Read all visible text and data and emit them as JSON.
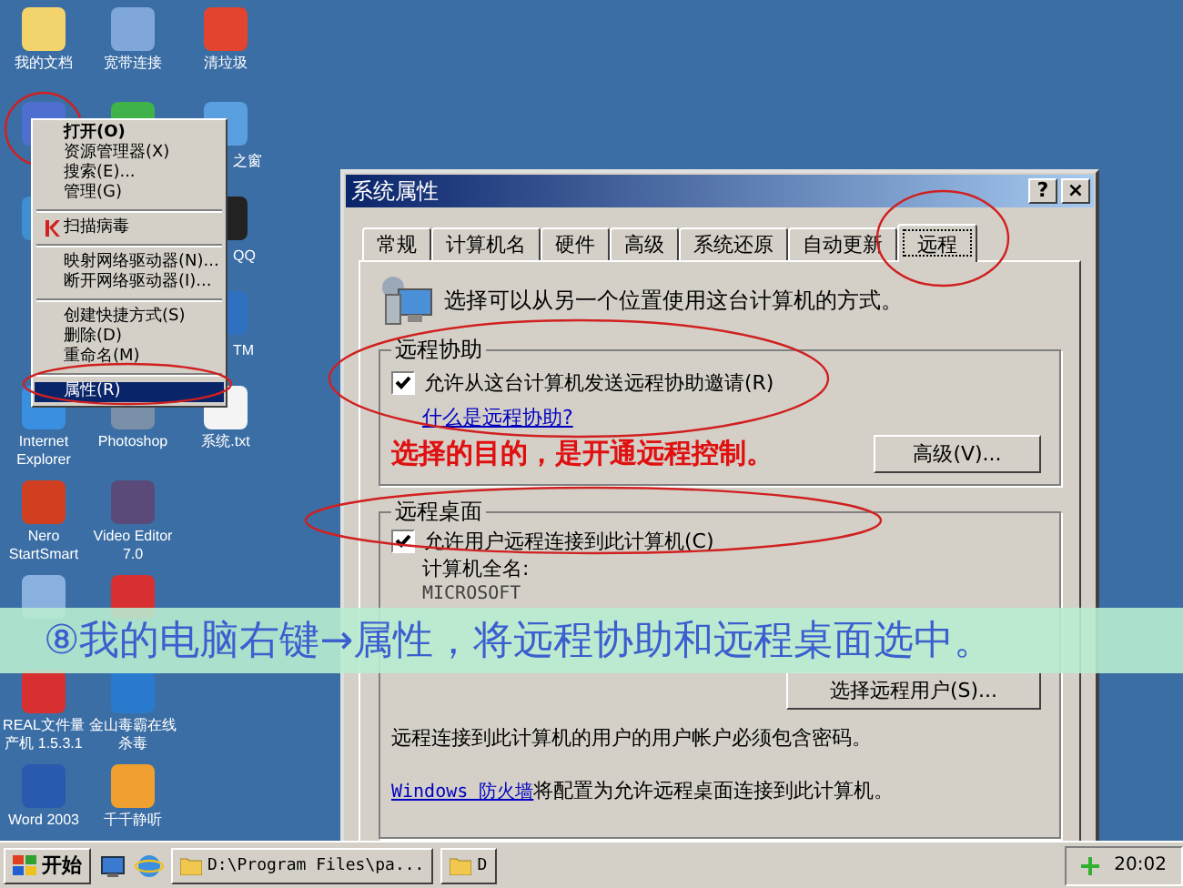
{
  "desktop_icons": [
    {
      "kind": "folder",
      "label": "我的文档"
    },
    {
      "kind": "network",
      "label": "宽带连接"
    },
    {
      "kind": "power",
      "label": "清垃圾"
    },
    {
      "kind": "computer"
    },
    {
      "kind": "shield"
    },
    {
      "kind": "globe",
      "label": "之窗"
    },
    {
      "kind": "network-places"
    },
    {
      "kind": "none"
    },
    {
      "kind": "penguin",
      "label": "QQ"
    },
    {
      "kind": "none"
    },
    {
      "kind": "none"
    },
    {
      "kind": "im",
      "label": "TM"
    },
    {
      "kind": "browser",
      "label": "Internet Explorer"
    },
    {
      "kind": "image",
      "label": "Photoshop"
    },
    {
      "kind": "text-file",
      "label": "系统.txt"
    },
    {
      "kind": "disc",
      "label": "Nero StartSmart"
    },
    {
      "kind": "video",
      "label": "Video Editor 7.0"
    },
    {
      "kind": "none"
    },
    {
      "kind": "media"
    },
    {
      "kind": "usb"
    },
    {
      "kind": "none"
    },
    {
      "kind": "usb",
      "label": "REAL文件量产机 1.5.3.1"
    },
    {
      "kind": "antivirus",
      "label": "金山毒霸在线杀毒"
    },
    {
      "kind": "none"
    },
    {
      "kind": "word",
      "label": "Word 2003"
    },
    {
      "kind": "music",
      "label": "千千静听"
    },
    {
      "kind": "none"
    }
  ],
  "context_menu": [
    {
      "kind": "item",
      "label": "打开(O)",
      "default": true,
      "selected": false
    },
    {
      "kind": "item",
      "label": "资源管理器(X)",
      "default": false,
      "selected": false
    },
    {
      "kind": "item",
      "label": "搜索(E)...",
      "default": false,
      "selected": false
    },
    {
      "kind": "item",
      "label": "管理(G)",
      "default": false,
      "selected": false
    },
    {
      "kind": "separator"
    },
    {
      "kind": "scan-item",
      "label": "扫描病毒",
      "default": false,
      "selected": false
    },
    {
      "kind": "separator"
    },
    {
      "kind": "item",
      "label": "映射网络驱动器(N)...",
      "default": false,
      "selected": false
    },
    {
      "kind": "item",
      "label": "断开网络驱动器(I)...",
      "default": false,
      "selected": false
    },
    {
      "kind": "separator"
    },
    {
      "kind": "item",
      "label": "创建快捷方式(S)",
      "default": false,
      "selected": false
    },
    {
      "kind": "item",
      "label": "删除(D)",
      "default": false,
      "selected": false
    },
    {
      "kind": "item",
      "label": "重命名(M)",
      "default": false,
      "selected": false
    },
    {
      "kind": "separator"
    },
    {
      "kind": "item",
      "label": "属性(R)",
      "default": false,
      "selected": true
    }
  ],
  "dialog": {
    "title": "系统属性",
    "help_button": "?",
    "close_button": "×",
    "tabs": [
      {
        "label": "常规",
        "selected": false
      },
      {
        "label": "计算机名",
        "selected": false
      },
      {
        "label": "硬件",
        "selected": false
      },
      {
        "label": "高级",
        "selected": false
      },
      {
        "label": "系统还原",
        "selected": false
      },
      {
        "label": "自动更新",
        "selected": false
      },
      {
        "label": "远程",
        "selected": true
      }
    ],
    "intro": "选择可以从另一个位置使用这台计算机的方式。",
    "remote_assistance": {
      "title": "远程协助",
      "checkbox": {
        "label": "允许从这台计算机发送远程协助邀请(R)",
        "checked": true
      },
      "link": "什么是远程协助?",
      "button": "高级(V)..."
    },
    "annotation": "选择的目的，是开通远程控制。",
    "remote_desktop": {
      "title": "远程桌面",
      "checkbox": {
        "label": "允许用户远程连接到此计算机(C)",
        "checked": true
      },
      "computer_name_label": "计算机全名:",
      "computer_name": "MICROSOFT",
      "button": "选择远程用户(S)...",
      "note": "远程连接到此计算机的用户的用户帐户必须包含密码。",
      "firewall_link": "Windows 防火墙",
      "firewall_text": "将配置为允许远程桌面连接到此计算机。"
    }
  },
  "caption": "⑧我的电脑右键→属性，将远程协助和远程桌面选中。",
  "taskbar": {
    "start": "开始",
    "tasks": [
      "D:\\Program Files\\pa...",
      "D"
    ],
    "clock": "20:02"
  }
}
